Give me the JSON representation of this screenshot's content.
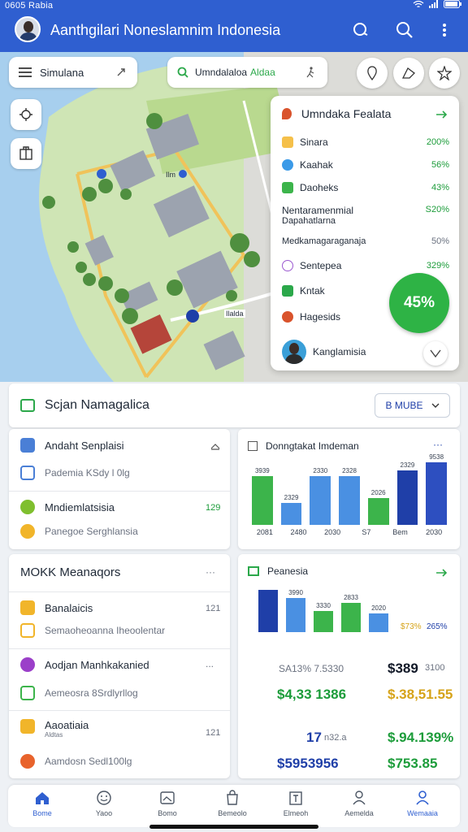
{
  "status_bar": {
    "time": "0605 Rabia"
  },
  "app_bar": {
    "title": "Aanthgilari Noneslamnim Indonesia"
  },
  "map": {
    "search_chip_1": "Simulana",
    "search_chip_2_main": "Umndalaloa",
    "search_chip_2_accent": "Aldaa",
    "pin_label_1": "Ilm",
    "pin_label_2": "Ilalda"
  },
  "poi_panel": {
    "title": "Umndaka Fealata",
    "items": [
      {
        "label": "Sinara",
        "pct": "200%",
        "color": "#f5c04a"
      },
      {
        "label": "Kaahak",
        "pct": "56%",
        "color": "#3b9ae8"
      },
      {
        "label": "Daoheks",
        "pct": "43%",
        "color": "#3cb44b"
      },
      {
        "label": "Nentaramenmial",
        "sublabel": "Dapahatlarna",
        "pct": "S20%",
        "color": ""
      },
      {
        "label": "Medkamagaraganaja",
        "pct": "50%",
        "color": ""
      },
      {
        "label": "Sentepea",
        "pct": "329%",
        "color": "#9b59d0"
      },
      {
        "label": "Kntak",
        "pct": "",
        "color": "#2ba84a"
      },
      {
        "label": "Hagesids",
        "pct": "",
        "color": "#d9532c"
      }
    ],
    "badge": "45%",
    "user_label": "Kanglamisia"
  },
  "summary_card": {
    "title": "Scjan Namagalica",
    "dropdown_label": "B MUBE"
  },
  "left_list_1": {
    "items": [
      {
        "label": "Andaht Senplaisi",
        "color": "#4a7fd6"
      },
      {
        "label": "Pademia KSdy l 0lg",
        "color": "#4a7fd6",
        "muted": true
      },
      {
        "label": "Mndiemlatsisia",
        "value": "129",
        "color": "#7fbf2e"
      },
      {
        "label": "Panegoe Serghlansia",
        "color": "#f1b52a",
        "muted": true
      }
    ]
  },
  "chart_card_1": {
    "title": "Donngtakat Imdeman",
    "chart_data": {
      "type": "bar",
      "categories": [
        "2081",
        "2480",
        "2030",
        "S7",
        "Bem",
        "2030"
      ],
      "bars": [
        {
          "value": 90,
          "label": "3939",
          "color": "#3cb44b",
          "category_index": 0
        },
        {
          "value": 40,
          "label": "2329",
          "color": "#4a90e2",
          "category_index": 1
        },
        {
          "value": 90,
          "label": "2330",
          "color": "#4a90e2",
          "category_index": 2
        },
        {
          "value": 90,
          "label": "2328",
          "color": "#4a90e2",
          "category_index": 3
        },
        {
          "value": 50,
          "label": "2026",
          "color": "#3cb44b",
          "category_index": 3
        },
        {
          "value": 100,
          "label": "2329",
          "color": "#1f3fa8",
          "category_index": 4
        },
        {
          "value": 115,
          "label": "9538",
          "color": "#2d4fc0",
          "category_index": 5
        }
      ]
    }
  },
  "left_list_2": {
    "title": "MOKK Meanaqors",
    "items": [
      {
        "label": "Banalaicis",
        "value": "121",
        "color": "#f1b52a"
      },
      {
        "label": "Semaoheoanna Iheoolentar",
        "color": "#f1b52a",
        "muted": true
      },
      {
        "label": "Aodjan Manhkakanied",
        "value": "...",
        "color": "#9b3fc9"
      },
      {
        "label": "Aemeosra 8Srdlyrllog",
        "color": "#3cb44b",
        "muted": true
      },
      {
        "label": "Aaoatiaia",
        "sublabel": "Aldtas",
        "value": "121",
        "color": "#f1b52a"
      },
      {
        "label": "Aamdosn Sedl100lg",
        "color": "#e8632c",
        "muted": true
      }
    ]
  },
  "chart_card_2": {
    "title": "Peanesia",
    "chart_data": {
      "type": "bar",
      "series_note": "",
      "bars": [
        {
          "value": 100,
          "label": "",
          "color": "#1f3fa8"
        },
        {
          "value": 80,
          "label": "3990",
          "color": "#4a90e2"
        },
        {
          "value": 50,
          "label": "3330",
          "color": "#3cb44b"
        },
        {
          "value": 70,
          "label": "2833",
          "color": "#3cb44b"
        },
        {
          "value": 45,
          "label": "2020",
          "color": "#4a90e2"
        }
      ],
      "legend_text_1": "$73%",
      "legend_text_2": "265%"
    },
    "figures": [
      {
        "left": "SA13% 7.5330",
        "right": "$389",
        "right_small": "3100",
        "left_color": "#6b7280",
        "right_color": "#111827"
      },
      {
        "left": "$4,33 1386",
        "right": "$.38,51.55",
        "left_color": "#1c9c3a",
        "right_color": "#d6a319"
      },
      {
        "left": "17",
        "left_small": "n32.a",
        "right": "$.94.139%",
        "left_color": "#1f3fa8",
        "right_color": "#1c9c3a"
      },
      {
        "left": "$5953956",
        "right": "$753.85",
        "left_color": "#1f3fa8",
        "right_color": "#1c9c3a"
      }
    ]
  },
  "bottom_nav": {
    "items": [
      {
        "label": "Bome",
        "icon": "home-icon",
        "active": true
      },
      {
        "label": "Yaoo",
        "icon": "face-icon"
      },
      {
        "label": "Bomo",
        "icon": "image-icon"
      },
      {
        "label": "Bemeolo",
        "icon": "bag-icon"
      },
      {
        "label": "Elmeoh",
        "icon": "calendar-icon"
      },
      {
        "label": "Aemelda",
        "icon": "person-icon"
      },
      {
        "label": "Wemaaia",
        "icon": "account-icon",
        "active": true
      }
    ]
  }
}
